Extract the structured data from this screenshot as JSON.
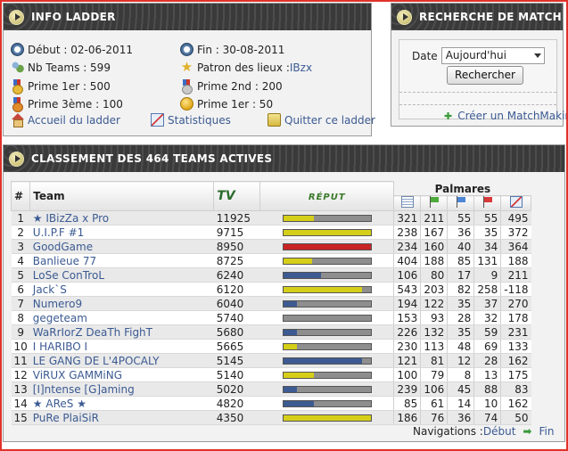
{
  "info": {
    "title": "INFO LADDER",
    "debut": "Début : 02-06-2011",
    "fin": "Fin : 30-08-2011",
    "nb_teams": "Nb Teams : 599",
    "patron_label": "Patron des lieux : ",
    "patron_value": "IBzx",
    "prime1": "Prime 1er : 500",
    "prime2": "Prime 2nd : 200",
    "prime3": "Prime 3ème : 100",
    "prime1b": "Prime 1er : 50",
    "accueil": "Accueil du ladder",
    "stats": "Statistiques",
    "quitter": "Quitter ce ladder"
  },
  "search": {
    "title": "RECHERCHE DE MATCH",
    "date_label": "Date",
    "date_value": "Aujourd'hui",
    "button": "Rechercher",
    "create_link": "Créer un MatchMaking"
  },
  "classement": {
    "title": "CLASSEMENT DES 464 TEAMS ACTIVES",
    "col_rank": "#",
    "col_team": "Team",
    "col_tv": "TV",
    "col_rep": "RÉPUT",
    "palmares": "Palmares",
    "rows": [
      {
        "rank": "1",
        "team": "IBizZa x Pro",
        "star_before": true,
        "star_after": false,
        "tv": "11925",
        "rep": 0.35,
        "rep_color": "#d6cf1a",
        "p": [
          "321",
          "211",
          "55",
          "55",
          "495"
        ]
      },
      {
        "rank": "2",
        "team": "U.I.P.F #1",
        "star_before": false,
        "star_after": false,
        "tv": "9715",
        "rep": 1.0,
        "rep_color": "#d6cf1a",
        "p": [
          "238",
          "167",
          "36",
          "35",
          "372"
        ]
      },
      {
        "rank": "3",
        "team": "GoodGame",
        "star_before": false,
        "star_after": false,
        "tv": "8950",
        "rep": 1.0,
        "rep_color": "#c92424",
        "p": [
          "234",
          "160",
          "40",
          "34",
          "364"
        ]
      },
      {
        "rank": "4",
        "team": "Banlieue 77",
        "star_before": false,
        "star_after": false,
        "tv": "8725",
        "rep": 0.33,
        "rep_color": "#d6cf1a",
        "p": [
          "404",
          "188",
          "85",
          "131",
          "188"
        ]
      },
      {
        "rank": "5",
        "team": "LoSe ConTroL",
        "star_before": false,
        "star_after": false,
        "tv": "6240",
        "rep": 0.43,
        "rep_color": "#3d5b92",
        "p": [
          "106",
          "80",
          "17",
          "9",
          "211"
        ]
      },
      {
        "rank": "6",
        "team": "Jack`S",
        "star_before": false,
        "star_after": false,
        "tv": "6120",
        "rep": 0.9,
        "rep_color": "#d6cf1a",
        "p": [
          "543",
          "203",
          "82",
          "258",
          "-118"
        ]
      },
      {
        "rank": "7",
        "team": "Numero9",
        "star_before": false,
        "star_after": false,
        "tv": "6040",
        "rep": 0.16,
        "rep_color": "#3d5b92",
        "p": [
          "194",
          "122",
          "35",
          "37",
          "270"
        ]
      },
      {
        "rank": "8",
        "team": "gegeteam",
        "star_before": false,
        "star_after": false,
        "tv": "5740",
        "rep": 0.0,
        "rep_color": "#d6cf1a",
        "p": [
          "153",
          "93",
          "28",
          "32",
          "178"
        ]
      },
      {
        "rank": "9",
        "team": "WaRrIorZ DeaTh FighT",
        "star_before": false,
        "star_after": false,
        "tv": "5680",
        "rep": 0.16,
        "rep_color": "#3d5b92",
        "p": [
          "226",
          "132",
          "35",
          "59",
          "231"
        ]
      },
      {
        "rank": "10",
        "team": "I HARIBO I",
        "star_before": false,
        "star_after": false,
        "tv": "5665",
        "rep": 0.16,
        "rep_color": "#d6cf1a",
        "p": [
          "230",
          "113",
          "48",
          "69",
          "133"
        ]
      },
      {
        "rank": "11",
        "team": "LE GANG DE L'4POCALY",
        "star_before": false,
        "star_after": false,
        "tv": "5145",
        "rep": 0.9,
        "rep_color": "#3d5b92",
        "p": [
          "121",
          "81",
          "12",
          "28",
          "162"
        ]
      },
      {
        "rank": "12",
        "team": "ViRUX GAMMiNG",
        "star_before": false,
        "star_after": false,
        "tv": "5140",
        "rep": 0.35,
        "rep_color": "#d6cf1a",
        "p": [
          "100",
          "79",
          "8",
          "13",
          "175"
        ]
      },
      {
        "rank": "13",
        "team": "[I]ntense [G]aming",
        "star_before": false,
        "star_after": false,
        "tv": "5020",
        "rep": 0.16,
        "rep_color": "#3d5b92",
        "p": [
          "239",
          "106",
          "45",
          "88",
          "83"
        ]
      },
      {
        "rank": "14",
        "team": "AReS",
        "star_before": true,
        "star_after": true,
        "tv": "4820",
        "rep": 0.35,
        "rep_color": "#3d5b92",
        "p": [
          "85",
          "61",
          "14",
          "10",
          "162"
        ]
      },
      {
        "rank": "15",
        "team": "PuRe PlaiSiR",
        "star_before": false,
        "star_after": false,
        "tv": "4350",
        "rep": 1.0,
        "rep_color": "#d6cf1a",
        "p": [
          "186",
          "76",
          "36",
          "74",
          "50"
        ]
      }
    ],
    "nav_label": "Navigations : ",
    "nav_debut": "Début",
    "nav_fin": "Fin"
  },
  "colors": {
    "link": "#3b5a92",
    "rep_yellow": "#d6cf1a",
    "rep_red": "#c92424",
    "rep_blue": "#3d5b92",
    "frame": "#e0322b"
  }
}
